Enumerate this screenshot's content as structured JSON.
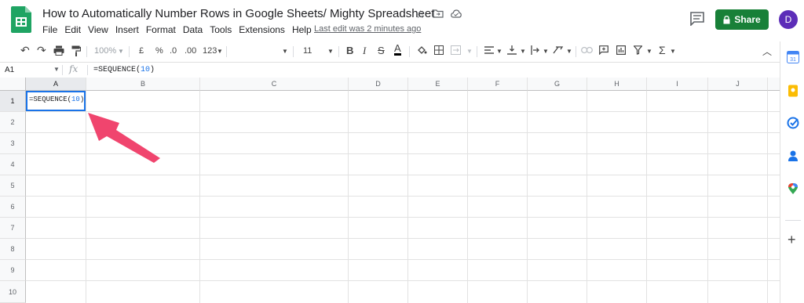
{
  "app": {
    "title": "How to Automatically Number Rows in Google Sheets/ Mighty Spreadsheet",
    "menu": [
      "File",
      "Edit",
      "View",
      "Insert",
      "Format",
      "Data",
      "Tools",
      "Extensions",
      "Help"
    ],
    "last_edit": "Last edit was 2 minutes ago",
    "share_label": "Share",
    "avatar_initial": "D"
  },
  "toolbar": {
    "zoom": "100%",
    "currency": "£",
    "percent": "%",
    "decimal_decrease": ".0",
    "decimal_increase": ".00",
    "more_formats": "123",
    "font_size": "11",
    "bold": "B",
    "italic": "I",
    "strikethrough": "S",
    "text_color": "A"
  },
  "formula_bar": {
    "name_box": "A1",
    "fx": "fx",
    "formula_prefix": "=SEQUENCE(",
    "formula_arg": "10",
    "formula_suffix": ")"
  },
  "grid": {
    "columns": [
      "A",
      "B",
      "C",
      "D",
      "E",
      "F",
      "G",
      "H",
      "I",
      "J"
    ],
    "rows": [
      "1",
      "2",
      "3",
      "4",
      "5",
      "6",
      "7",
      "8",
      "9",
      "10"
    ],
    "active_cell": "A1",
    "active_cell_content_prefix": "=SEQUENCE(",
    "active_cell_content_arg": "10",
    "active_cell_content_suffix": ")"
  },
  "colors": {
    "share_green": "#188038",
    "selection_blue": "#1a73e8",
    "arrow_pink": "#f0456e",
    "avatar_purple": "#5c2db8"
  },
  "side_panel": {
    "icons": [
      "calendar-icon",
      "keep-icon",
      "tasks-icon",
      "contacts-icon",
      "maps-icon",
      "add-icon"
    ]
  }
}
